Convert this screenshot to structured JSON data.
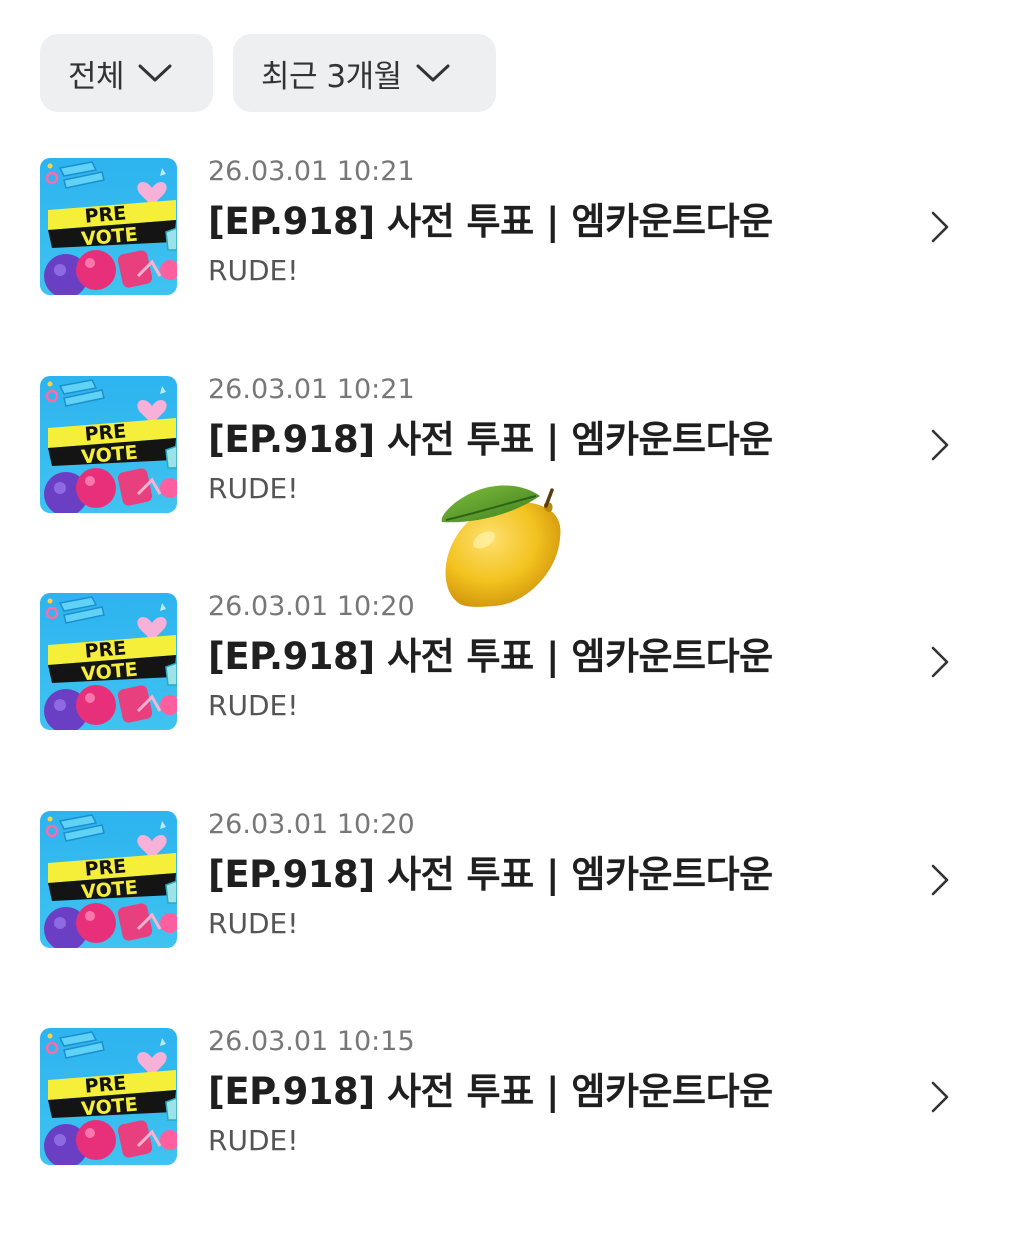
{
  "filters": {
    "category": {
      "label": "전체",
      "icon": "chevron-down-icon"
    },
    "period": {
      "label": "최근 3개월",
      "icon": "chevron-down-icon"
    }
  },
  "thumbnail": {
    "line1": "PRE",
    "line2": "VOTE",
    "colors": {
      "sky": "#3fc3f0",
      "banner": "#f5ef3a",
      "heart": "#f7b0d8",
      "balloon": "#e8307a",
      "sphere": "#6a3fc4"
    }
  },
  "history": [
    {
      "time": "26.03.01 10:21",
      "title": "[EP.918] 사전 투표 | 엠카운트다운",
      "subtitle": "RUDE!"
    },
    {
      "time": "26.03.01 10:21",
      "title": "[EP.918] 사전 투표 | 엠카운트다운",
      "subtitle": "RUDE!"
    },
    {
      "time": "26.03.01 10:20",
      "title": "[EP.918] 사전 투표 | 엠카운트다운",
      "subtitle": "RUDE!"
    },
    {
      "time": "26.03.01 10:20",
      "title": "[EP.918] 사전 투표 | 엠카운트다운",
      "subtitle": "RUDE!"
    },
    {
      "time": "26.03.01 10:15",
      "title": "[EP.918] 사전 투표 | 엠카운트다운",
      "subtitle": "RUDE!"
    }
  ],
  "sticker": {
    "icon": "lemon-icon"
  }
}
